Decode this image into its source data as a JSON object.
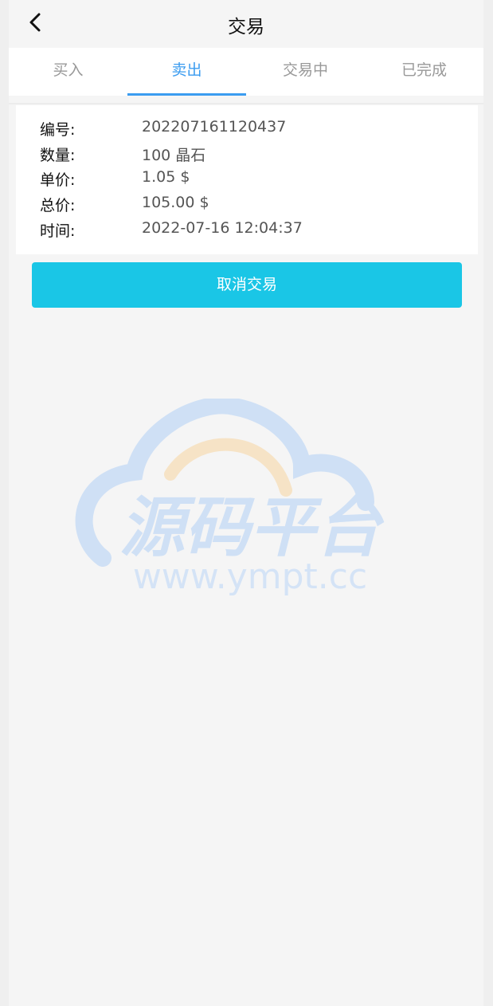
{
  "header": {
    "title": "交易",
    "back_icon": "chevron-left-icon"
  },
  "tabs": [
    {
      "label": "买入",
      "active": false
    },
    {
      "label": "卖出",
      "active": true
    },
    {
      "label": "交易中",
      "active": false
    },
    {
      "label": "已完成",
      "active": false
    }
  ],
  "order": {
    "fields": [
      {
        "key": "编号:",
        "value": "202207161120437"
      },
      {
        "key": "数量:",
        "value": "100 晶石"
      },
      {
        "key": "单价:",
        "value": "1.05 $"
      },
      {
        "key": "总价:",
        "value": "105.00 $"
      },
      {
        "key": "时间:",
        "value": "2022-07-16 12:04:37"
      }
    ]
  },
  "actions": {
    "cancel_label": "取消交易"
  },
  "watermark": {
    "text_cn": "源码平台",
    "url": "www.ympt.cc"
  },
  "colors": {
    "accent": "#3b9cf0",
    "button": "#1ac6e6",
    "background": "#f5f5f5"
  }
}
